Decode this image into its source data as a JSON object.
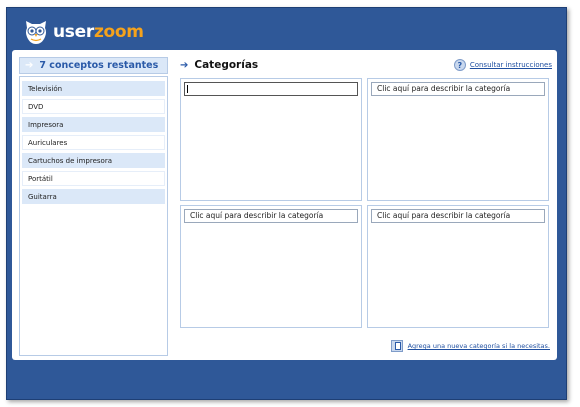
{
  "logo": {
    "part1": "user",
    "part2": "zoom"
  },
  "left": {
    "header": "7 conceptos restantes",
    "items": [
      {
        "label": "Televisión",
        "shaded": true
      },
      {
        "label": "DVD",
        "shaded": false
      },
      {
        "label": "Impresora",
        "shaded": true
      },
      {
        "label": "Auriculares",
        "shaded": false
      },
      {
        "label": "Cartuchos de impresora",
        "shaded": true
      },
      {
        "label": "Portátil",
        "shaded": false
      },
      {
        "label": "Guitarra",
        "shaded": true
      }
    ]
  },
  "main": {
    "title": "Categorías",
    "help_link": "Consultar instrucciones",
    "categories": [
      {
        "value": "",
        "active": true
      },
      {
        "value": "Clic aquí para describir la categoría",
        "active": false
      },
      {
        "value": "Clic aquí para describir la categoría",
        "active": false
      },
      {
        "value": "Clic aquí para describir la categoría",
        "active": false
      }
    ],
    "add_link": "Agrega una nueva categoría si la necesitas."
  },
  "colors": {
    "frame": "#2f5898",
    "accent": "#f5a21c",
    "shade": "#dbe8f8"
  }
}
